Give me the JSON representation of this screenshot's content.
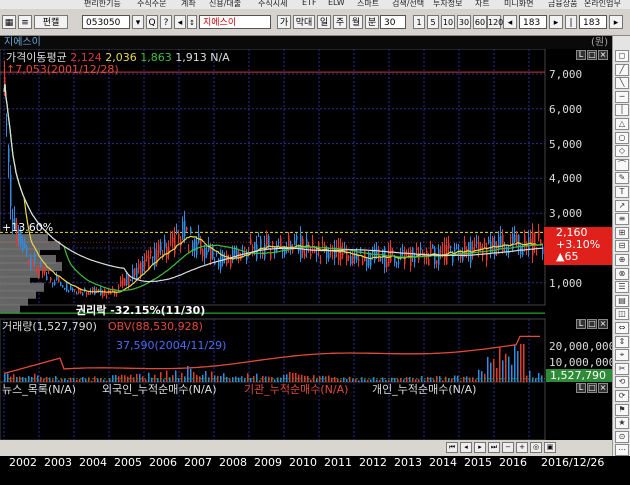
{
  "menubar": {
    "items": [
      "편리한기능",
      "주식주문",
      "계좌",
      "신용/대출",
      "주식시세",
      "ETF",
      "ELW",
      "스마트",
      "검색/선택",
      "투자정보",
      "차트",
      "미니화면",
      "금융상품",
      "온라인업무"
    ]
  },
  "toolbar": {
    "code": "053050",
    "market_tab": "펀캘",
    "stock_name": "지에스이",
    "ga": "가",
    "chart_type": "막대",
    "period_day": "일",
    "period_week": "주",
    "period_month": "월",
    "minute": "분",
    "minute_value": "30",
    "counts": [
      "1",
      "5",
      "10",
      "30",
      "60",
      "120"
    ],
    "view_count_1": "183",
    "view_count_2": "183"
  },
  "window": {
    "title": "지에스이",
    "corner": "(원)"
  },
  "chart": {
    "ma_label": "가격이동평균",
    "ma_values": [
      "2,124",
      "2,036",
      "1,863",
      "1,913",
      "N/A"
    ],
    "ma_colors": [
      "#d63b3b",
      "#e8d84a",
      "#3cc03c",
      "#dddddd",
      "#dddddd"
    ],
    "high_label": "7,053(2001/12/28)",
    "low_label": "권리락",
    "low_pct": "-32.15%",
    "low_date_label": "(11/30)",
    "pct_label": "+13.60%",
    "yticks": [
      "7,000",
      "6,000",
      "5,000",
      "4,000",
      "3,000",
      "2,000",
      "1,000"
    ],
    "last_price": "2,160",
    "last_change_pct": "+3.10%",
    "last_change": "▲65",
    "volume_label": "거래량(1,527,790)",
    "obv_label": "OBV(88,530,928)",
    "obv_value_label": "37,590(2004/11/29)",
    "vol_yticks": [
      "20,000,000",
      "10,000,000"
    ],
    "vol_last": "1,527,790",
    "news_label": "뉴스_목록(N/A)",
    "foreign_label": "외국인_누적순매수(N/A)",
    "inst_label": "기관_누적순매수(N/A)",
    "indiv_label": "개인_누적순매수(N/A)",
    "x_years": [
      "2002",
      "2003",
      "2004",
      "2005",
      "2006",
      "2007",
      "2008",
      "2009",
      "2010",
      "2011",
      "2012",
      "2013",
      "2014",
      "2015",
      "2016"
    ],
    "x_last_date": "2016/12/26"
  },
  "chart_data": {
    "type": "line",
    "x": [
      "2002",
      "2003",
      "2004",
      "2005",
      "2006",
      "2007",
      "2008",
      "2009",
      "2010",
      "2011",
      "2012",
      "2013",
      "2014",
      "2015",
      "2016",
      "2016/12/26"
    ],
    "series": [
      {
        "name": "가격이동평균",
        "values": [
          2900,
          1300,
          800,
          700,
          1600,
          2400,
          1600,
          2000,
          2100,
          1800,
          1700,
          1750,
          1800,
          1900,
          2050,
          2160
        ]
      }
    ],
    "ylim": [
      0,
      7600
    ],
    "yticks": [
      1000,
      2000,
      3000,
      4000,
      5000,
      6000,
      7000
    ],
    "high": 7053,
    "last": 2160,
    "volume_series": [
      {
        "name": "거래량",
        "values": [
          3000000,
          2500000,
          1500000,
          2000000,
          3000000,
          5000000,
          3000000,
          2500000,
          3000000,
          2000000,
          1500000,
          1500000,
          2000000,
          2000000,
          15000000,
          1527790
        ]
      }
    ],
    "obv": 88530928,
    "grid": true
  }
}
